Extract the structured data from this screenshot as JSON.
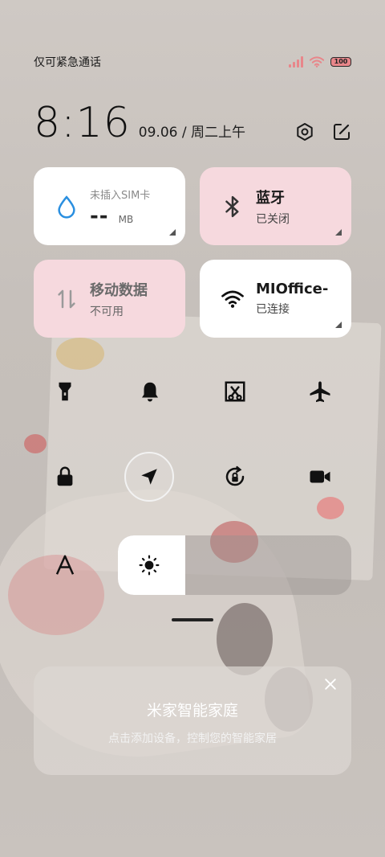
{
  "status_bar": {
    "carrier_text": "仅可紧急通话",
    "battery_level": "100",
    "signal_icon": "signal-icon",
    "wifi_icon": "wifi-icon"
  },
  "header": {
    "time": "8:16",
    "date": "09.06 / 周二上午",
    "settings_icon": "settings-icon",
    "edit_icon": "edit-icon"
  },
  "tiles": {
    "data": {
      "label": "未插入SIM卡",
      "value": "--",
      "unit": "MB",
      "icon": "droplet-icon"
    },
    "bluetooth": {
      "label": "蓝牙",
      "state": "已关闭",
      "icon": "bluetooth-icon"
    },
    "mobile_data": {
      "label": "移动数据",
      "state": "不可用",
      "icon": "mobile-data-icon"
    },
    "wifi": {
      "label": "MIOffice-",
      "state": "已连接",
      "icon": "wifi-icon"
    }
  },
  "toggles": [
    {
      "name": "flashlight",
      "icon": "flashlight-icon"
    },
    {
      "name": "ringer",
      "icon": "bell-icon"
    },
    {
      "name": "screenshot",
      "icon": "screenshot-icon"
    },
    {
      "name": "airplane-mode",
      "icon": "airplane-icon"
    },
    {
      "name": "lock-screen",
      "icon": "lock-icon"
    },
    {
      "name": "location",
      "icon": "location-arrow-icon"
    },
    {
      "name": "auto-rotate",
      "icon": "rotate-lock-icon"
    },
    {
      "name": "screen-record",
      "icon": "video-camera-icon"
    },
    {
      "name": "font-size",
      "icon": "font-icon"
    }
  ],
  "brightness": {
    "level": 0.29,
    "icon": "sun-icon"
  },
  "mijia_card": {
    "title": "米家智能家庭",
    "subtitle": "点击添加设备，控制您的智能家居",
    "close_icon": "close-icon"
  },
  "colors": {
    "tile_active_white": "#ffffff",
    "tile_pink": "#f6d9de",
    "signal_pink": "#e8868a",
    "wifi_pink": "#e8868a",
    "bluetooth_tile": "#f6d9de",
    "wifi_accent": "#4aa3df"
  }
}
